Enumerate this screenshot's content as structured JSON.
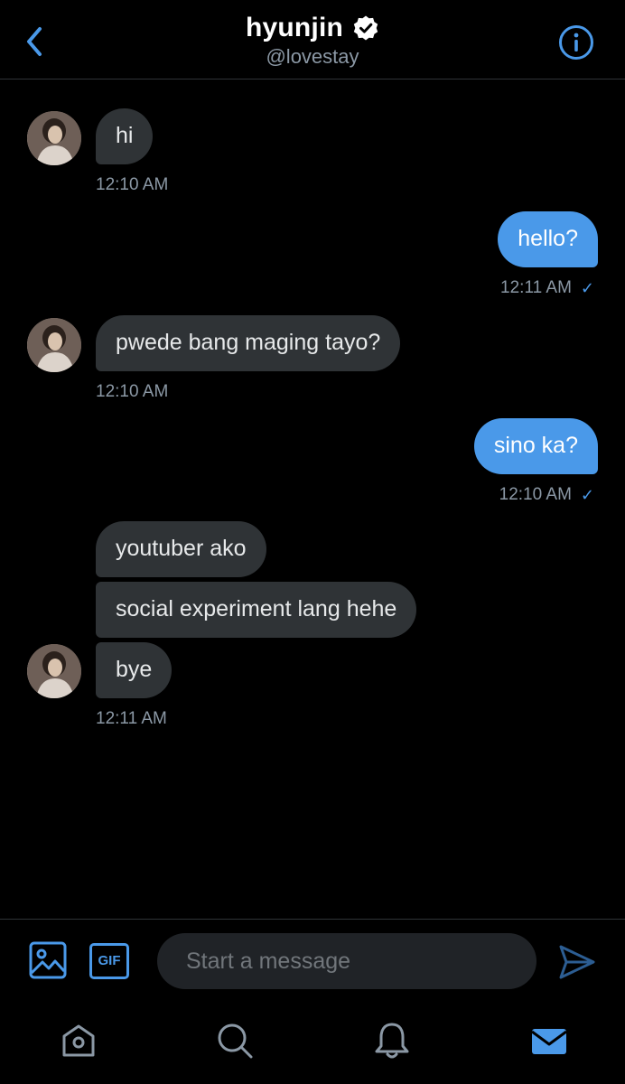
{
  "header": {
    "name": "hyunjin",
    "handle": "@lovestay",
    "verified": true
  },
  "messages": [
    {
      "direction": "in",
      "text": "hi"
    },
    {
      "direction": "in",
      "time": "12:10 AM"
    },
    {
      "direction": "out",
      "text": "hello?"
    },
    {
      "direction": "out",
      "time": "12:11 AM",
      "status": "read"
    },
    {
      "direction": "in",
      "text": "pwede bang maging tayo?"
    },
    {
      "direction": "in",
      "time": "12:10 AM"
    },
    {
      "direction": "out",
      "text": "sino ka?"
    },
    {
      "direction": "out",
      "time": "12:10 AM",
      "status": "read"
    },
    {
      "direction": "in",
      "text": "youtuber ako"
    },
    {
      "direction": "in",
      "text": "social experiment lang hehe"
    },
    {
      "direction": "in",
      "text": "bye"
    },
    {
      "direction": "in",
      "time": "12:11 AM"
    }
  ],
  "composer": {
    "placeholder": "Start a message",
    "gif_label": "GIF",
    "media_icon": "image-icon",
    "send_icon": "send-icon"
  },
  "nav": {
    "items": [
      "home-icon",
      "search-icon",
      "notifications-icon",
      "messages-icon"
    ],
    "active": "messages-icon"
  },
  "colors": {
    "accent": "#4a99e9",
    "incoming_bubble": "#2f3336",
    "background": "#000000",
    "muted_text": "#8b98a5"
  }
}
